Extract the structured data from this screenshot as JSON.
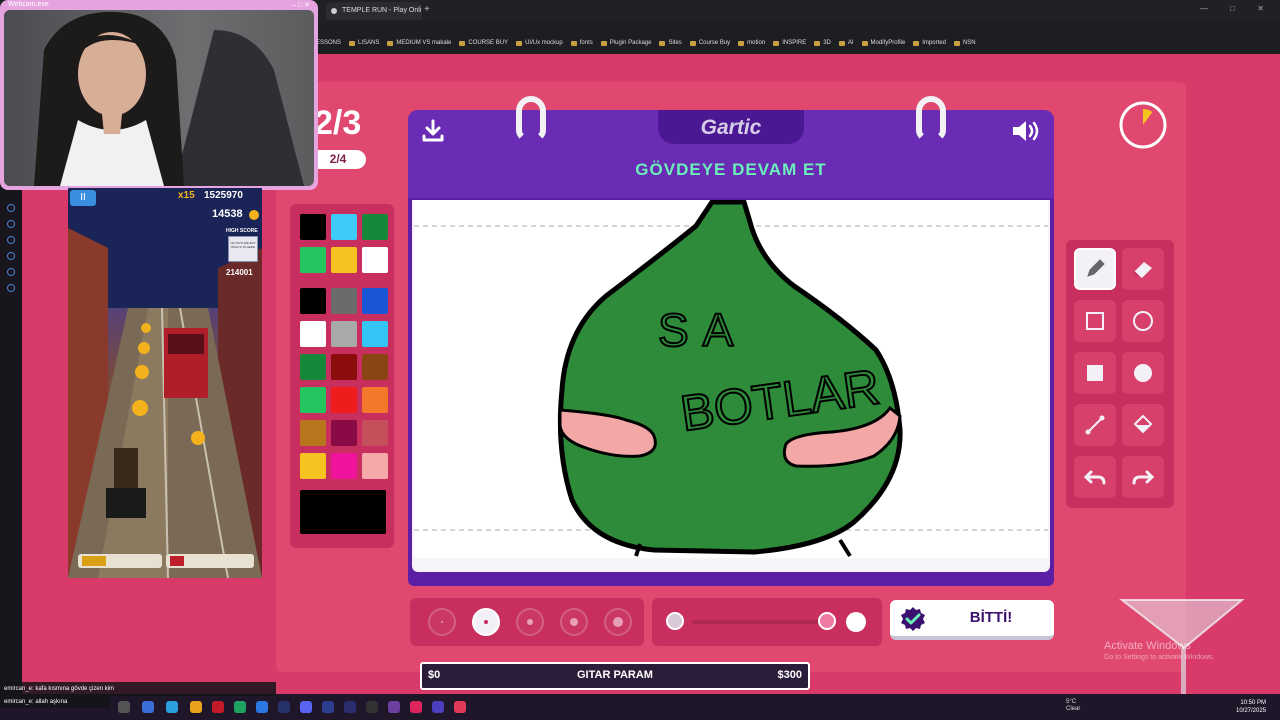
{
  "browser": {
    "tab_title": "TEMPLE RUN - Play Onli",
    "new_tab": "+",
    "window_controls": "— □ ✕",
    "bookmarks": [
      "ESSONS",
      "LISANS",
      "MEDIUM VS makale",
      "COURSE BUY",
      "UI/Ux mockup",
      "fonts",
      "Plugin Package",
      "Sites",
      "Course Buy",
      "motion",
      "INSPIRE",
      "3D",
      "AI",
      "ModifyProfile",
      "Imported",
      "NSN"
    ]
  },
  "webcam": {
    "title": "Webcam.exe",
    "controls": "– □ ✕"
  },
  "subway": {
    "score": "1525970",
    "multiplier": "x15",
    "coins": "14538",
    "high_score_label": "HIGH SCORE",
    "high_score_sign": "NO PICTURE BUT WALLS! IN HERE",
    "high_score_value": "214001",
    "pause": "II"
  },
  "game": {
    "round_big": "2/3",
    "round_small": "2/4",
    "logo": "Gartic",
    "prompt": "GÖVDEYE DEVAM ET",
    "drawing_text_1": "SA",
    "drawing_text_2": "BOTLAR",
    "done_label": "BİTTİ!",
    "timer_fraction": 0.1
  },
  "palette": {
    "top": [
      "#000000",
      "#3ecbf7",
      "#17873a",
      "#22c55e",
      "#f7c321",
      "#ffffff"
    ],
    "grid": [
      "#000000",
      "#6b6b6b",
      "#1a56d6",
      "#ffffff",
      "#a9a9a9",
      "#33c6f4",
      "#17873a",
      "#8b0d0d",
      "#8a4513",
      "#22c55e",
      "#ef1c1c",
      "#f4782a",
      "#b8771d",
      "#8a0a45",
      "#c4505b",
      "#f7c321",
      "#f0139b",
      "#f6a7a7"
    ],
    "selected": "#000000"
  },
  "tools": [
    "pencil-icon",
    "eraser-icon",
    "square-outline-icon",
    "circle-outline-icon",
    "square-filled-icon",
    "circle-filled-icon",
    "line-icon",
    "fill-bucket-icon",
    "undo-icon",
    "redo-icon"
  ],
  "brush": {
    "selected_index": 1,
    "count": 5
  },
  "opacity": {
    "value": 1.0
  },
  "gitar": {
    "min": "$0",
    "label": "GITAR PARAM",
    "max": "$300"
  },
  "watermark": {
    "title": "Activate Windows",
    "subtitle": "Go to Settings to activate Windows."
  },
  "chat": {
    "line1": "emircan_e: kafa kısmına gövde çizen kim",
    "line2": "emircan_e: allah aşkına"
  },
  "taskbar": {
    "weather_temp": "5°C",
    "weather_desc": "Clear",
    "time": "10:50 PM",
    "date": "10/27/2025"
  },
  "colors": {
    "accent": "#d83a6a",
    "book": "#5b1fa6",
    "prompt": "#6cf0b9"
  }
}
